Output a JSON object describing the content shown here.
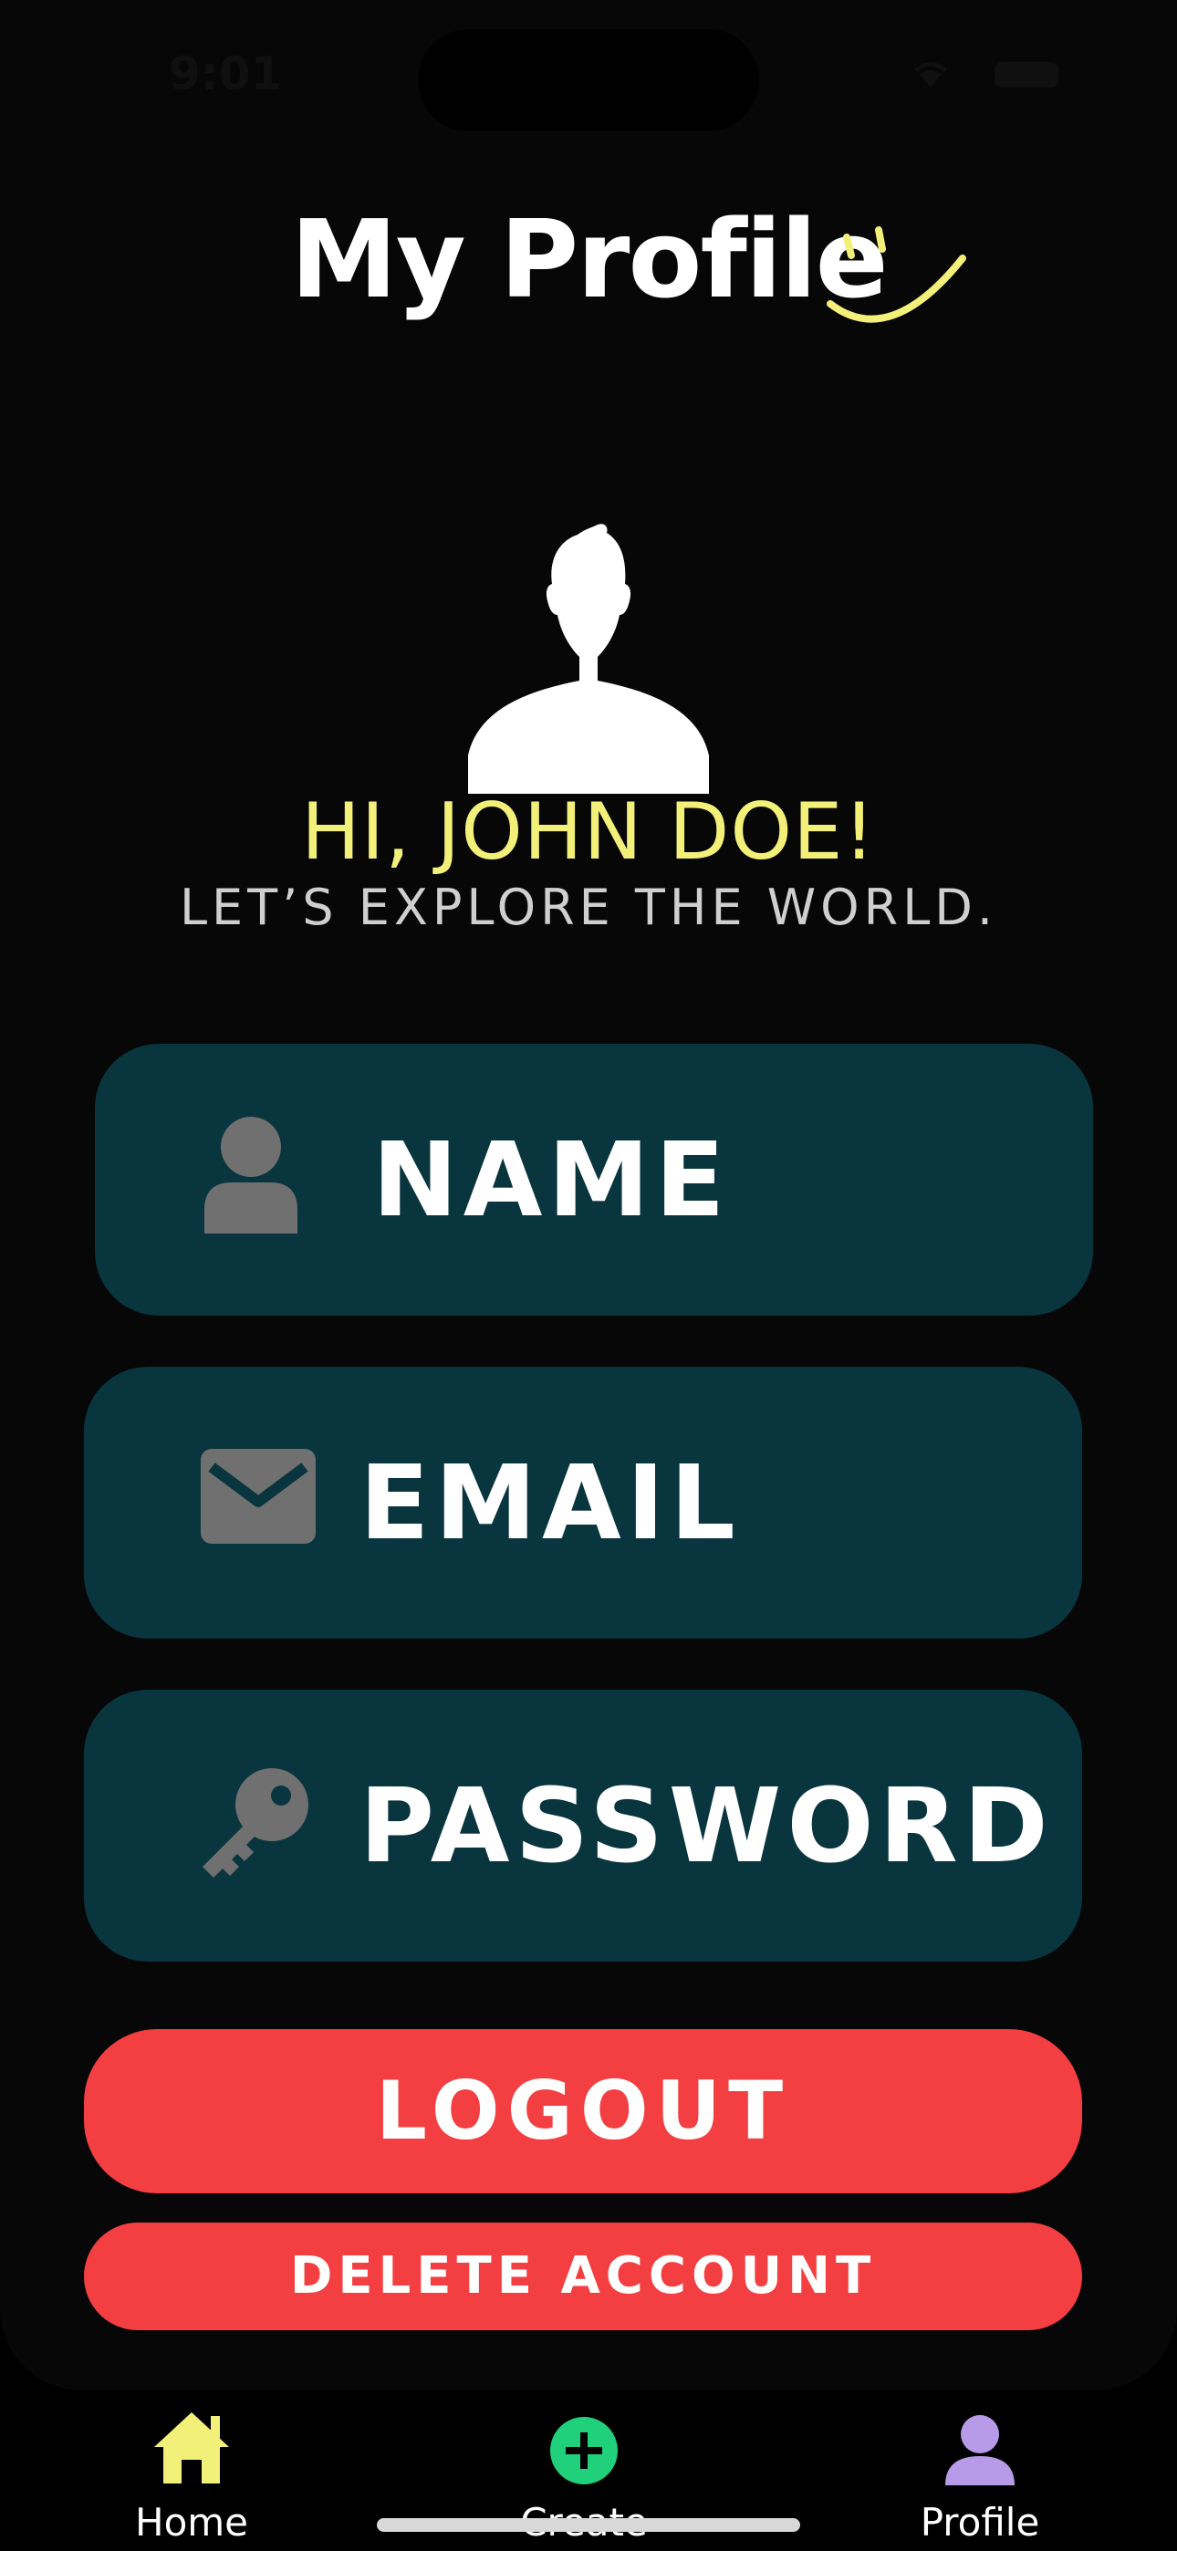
{
  "status": {
    "time": "9:01"
  },
  "header": {
    "title": "My Profile"
  },
  "greeting": {
    "hello": "HI, JOHN DOE!",
    "sub": "LET’S EXPLORE THE WORLD."
  },
  "fields": [
    {
      "label": "NAME",
      "icon": "user-icon"
    },
    {
      "label": "EMAIL",
      "icon": "envelope-icon"
    },
    {
      "label": "PASSWORD",
      "icon": "key-icon"
    }
  ],
  "actions": {
    "logout": "LOGOUT",
    "delete": "DELETE ACCOUNT"
  },
  "tabbar": {
    "home": {
      "label": "Home",
      "icon": "house-icon"
    },
    "create": {
      "label": "Create",
      "icon": "plus-circle-icon"
    },
    "profile": {
      "label": "Profile",
      "icon": "person-icon"
    }
  },
  "colors": {
    "background": "#070707",
    "field": "#09353f",
    "accent_yellow": "#f3f07a",
    "danger": "#f33f41",
    "create_green": "#21d07a",
    "profile_purple": "#b79be8",
    "icon_gray": "#707070"
  }
}
